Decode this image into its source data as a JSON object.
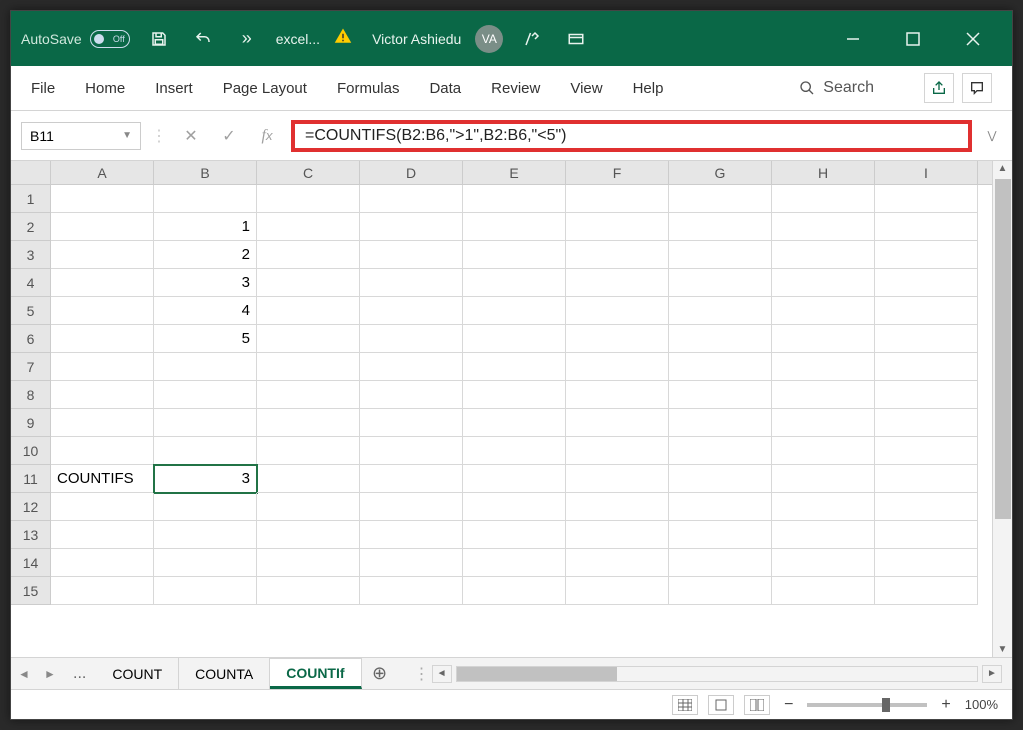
{
  "titlebar": {
    "autosave_label": "AutoSave",
    "autosave_state": "Off",
    "filename": "excel...",
    "username": "Victor Ashiedu",
    "avatar_initials": "VA"
  },
  "ribbon": {
    "tabs": [
      "File",
      "Home",
      "Insert",
      "Page Layout",
      "Formulas",
      "Data",
      "Review",
      "View",
      "Help"
    ],
    "search_label": "Search"
  },
  "formula_bar": {
    "name_box": "B11",
    "formula": "=COUNTIFS(B2:B6,\">1\",B2:B6,\"<5\")"
  },
  "grid": {
    "columns": [
      "A",
      "B",
      "C",
      "D",
      "E",
      "F",
      "G",
      "H",
      "I"
    ],
    "rows": [
      {
        "n": "1",
        "cells": [
          "",
          "",
          "",
          "",
          "",
          "",
          "",
          "",
          ""
        ]
      },
      {
        "n": "2",
        "cells": [
          "",
          "1",
          "",
          "",
          "",
          "",
          "",
          "",
          ""
        ]
      },
      {
        "n": "3",
        "cells": [
          "",
          "2",
          "",
          "",
          "",
          "",
          "",
          "",
          ""
        ]
      },
      {
        "n": "4",
        "cells": [
          "",
          "3",
          "",
          "",
          "",
          "",
          "",
          "",
          ""
        ]
      },
      {
        "n": "5",
        "cells": [
          "",
          "4",
          "",
          "",
          "",
          "",
          "",
          "",
          ""
        ]
      },
      {
        "n": "6",
        "cells": [
          "",
          "5",
          "",
          "",
          "",
          "",
          "",
          "",
          ""
        ]
      },
      {
        "n": "7",
        "cells": [
          "",
          "",
          "",
          "",
          "",
          "",
          "",
          "",
          ""
        ]
      },
      {
        "n": "8",
        "cells": [
          "",
          "",
          "",
          "",
          "",
          "",
          "",
          "",
          ""
        ]
      },
      {
        "n": "9",
        "cells": [
          "",
          "",
          "",
          "",
          "",
          "",
          "",
          "",
          ""
        ]
      },
      {
        "n": "10",
        "cells": [
          "",
          "",
          "",
          "",
          "",
          "",
          "",
          "",
          ""
        ]
      },
      {
        "n": "11",
        "cells": [
          "COUNTIFS",
          "3",
          "",
          "",
          "",
          "",
          "",
          "",
          ""
        ]
      },
      {
        "n": "12",
        "cells": [
          "",
          "",
          "",
          "",
          "",
          "",
          "",
          "",
          ""
        ]
      },
      {
        "n": "13",
        "cells": [
          "",
          "",
          "",
          "",
          "",
          "",
          "",
          "",
          ""
        ]
      },
      {
        "n": "14",
        "cells": [
          "",
          "",
          "",
          "",
          "",
          "",
          "",
          "",
          ""
        ]
      },
      {
        "n": "15",
        "cells": [
          "",
          "",
          "",
          "",
          "",
          "",
          "",
          "",
          ""
        ]
      }
    ],
    "selected": {
      "row": 10,
      "col": 1
    }
  },
  "sheets": {
    "ellipsis": "...",
    "tabs": [
      {
        "label": "COUNT",
        "active": false
      },
      {
        "label": "COUNTA",
        "active": false
      },
      {
        "label": "COUNTIf",
        "active": true
      }
    ]
  },
  "statusbar": {
    "zoom": "100%"
  }
}
